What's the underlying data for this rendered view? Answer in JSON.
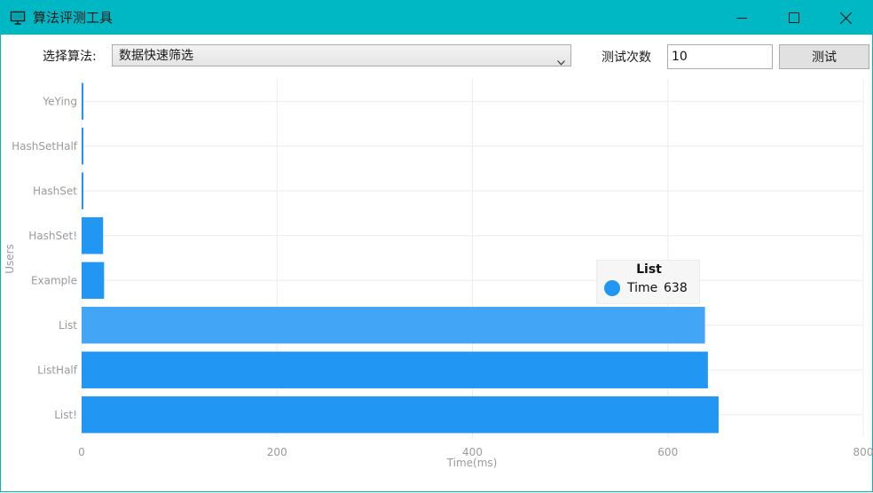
{
  "window": {
    "title": "算法评测工具",
    "title_bar_color": "#00b8c4",
    "icon": "presentation-monitor-icon",
    "controls": [
      "minimize-icon",
      "maximize-icon",
      "close-icon"
    ]
  },
  "toolbar": {
    "algorithm_label": "选择算法:",
    "algorithm_selected": "数据快速筛选",
    "iterations_label": "测试次数",
    "iterations_value": "10",
    "test_button": "测试"
  },
  "chart_data": {
    "type": "bar",
    "orientation": "horizontal",
    "categories": [
      "YeYing",
      "HashSetHalf",
      "HashSet",
      "HashSet!",
      "Example",
      "List",
      "ListHalf",
      "List!"
    ],
    "series": [
      {
        "name": "Time",
        "values": [
          1,
          1,
          1,
          22,
          23,
          638,
          641,
          652
        ],
        "color": "#2196f3"
      }
    ],
    "xlabel": "Time(ms)",
    "ylabel": "Users",
    "xlim": [
      0,
      800
    ],
    "xticks": [
      "0",
      "200",
      "400",
      "600",
      "800"
    ],
    "grid": true,
    "highlighted_category": "List",
    "highlight_color": "#42a5f5"
  },
  "tooltip": {
    "title": "List",
    "series_name": "Time",
    "value": "638"
  }
}
